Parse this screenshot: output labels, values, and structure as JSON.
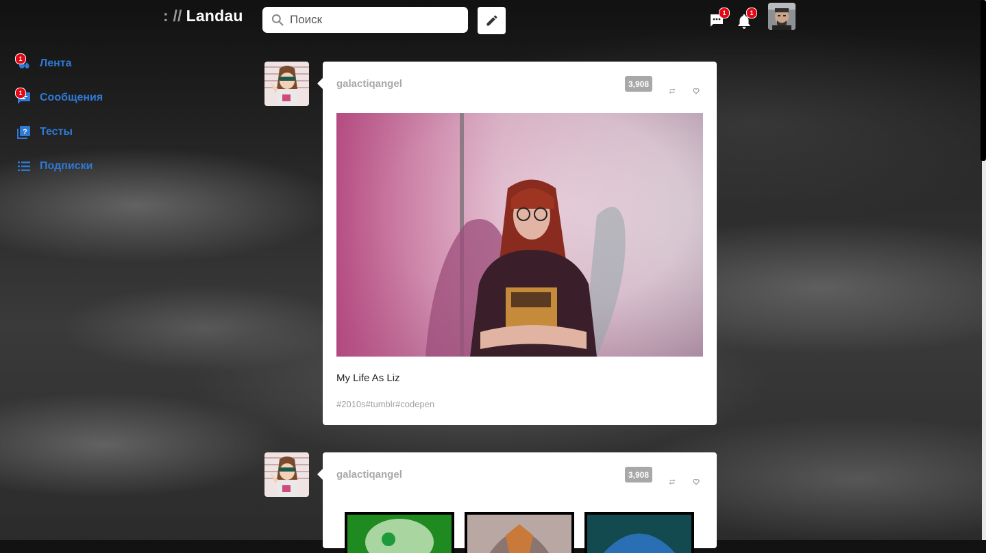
{
  "header": {
    "logo_prefix": ": //",
    "logo_name": "Landau",
    "search_placeholder": "Поиск",
    "messages_badge": "1",
    "notifications_badge": "1"
  },
  "sidebar": {
    "items": [
      {
        "label": "Лента",
        "icon": "feed-icon",
        "badge": "1"
      },
      {
        "label": "Сообщения",
        "icon": "chat-icon",
        "badge": "1"
      },
      {
        "label": "Тесты",
        "icon": "quiz-icon"
      },
      {
        "label": "Подписки",
        "icon": "list-icon"
      }
    ]
  },
  "posts": [
    {
      "username": "galactiqangel",
      "notes": "3,908",
      "caption": "My Life As Liz",
      "tags": "#2010s#tumblr#codepen"
    },
    {
      "username": "galactiqangel",
      "notes": "3,908"
    }
  ],
  "colors": {
    "accent": "#2e7ad6",
    "badge": "#e30613",
    "notes_pill": "#a8a8a8"
  }
}
